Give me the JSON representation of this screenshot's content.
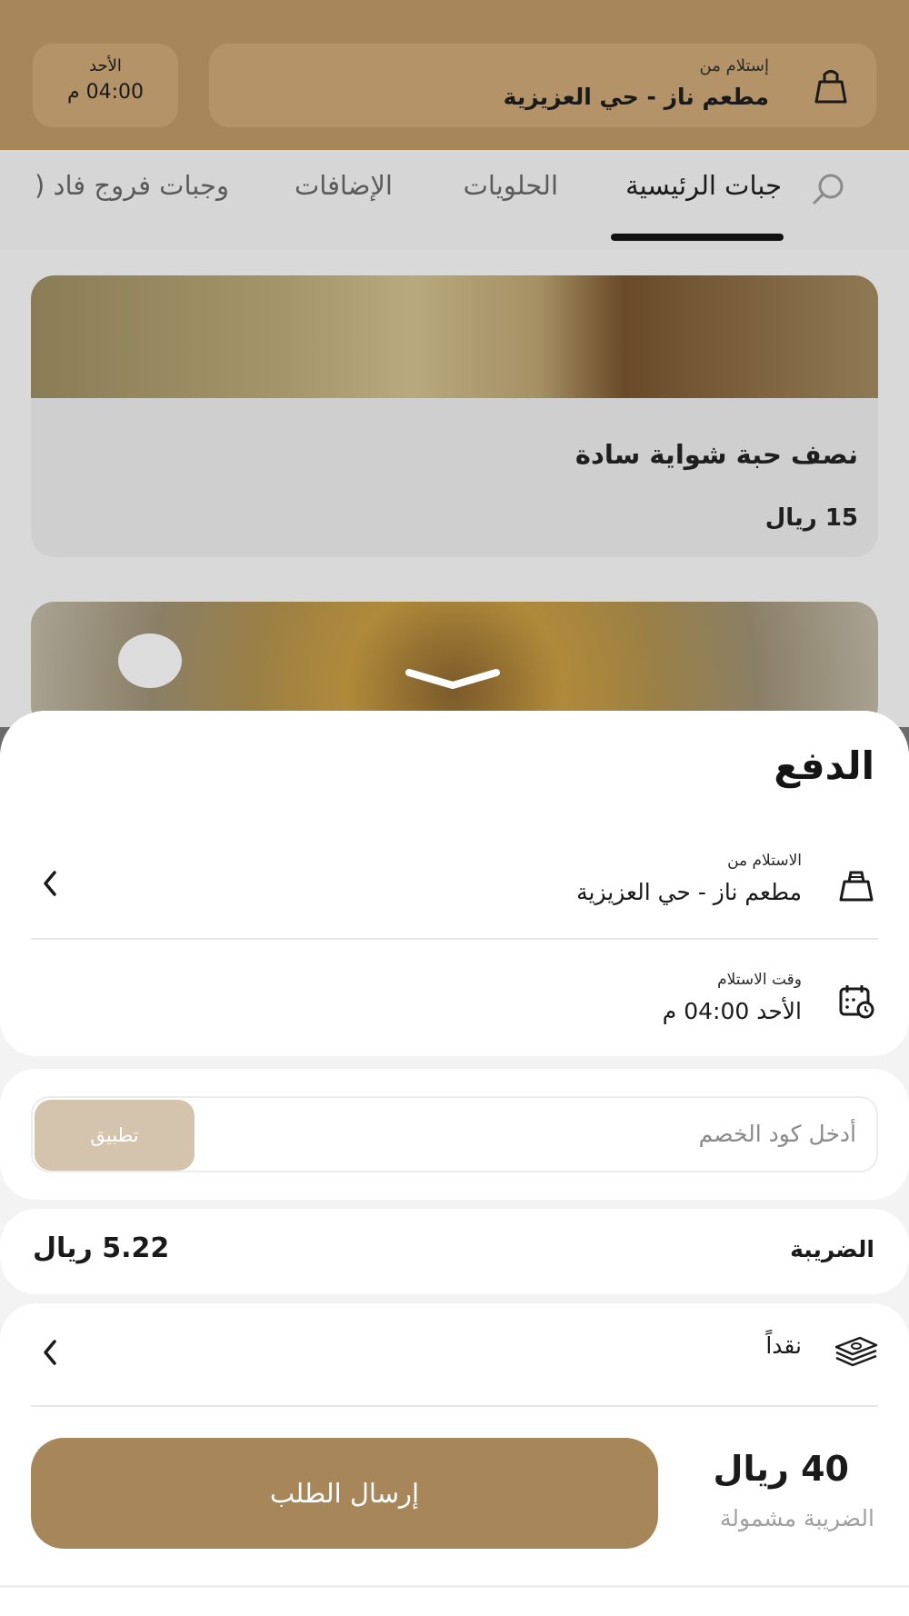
{
  "header": {
    "pickup_label": "إستلام من",
    "pickup_value": "مطعم ناز - حي العزيزية",
    "day": "الأحد",
    "time": "04:00 م"
  },
  "tabs": [
    {
      "label": "جبات الرئيسية",
      "active": true
    },
    {
      "label": "الحلويات",
      "active": false
    },
    {
      "label": "الإضافات",
      "active": false
    },
    {
      "label": "وجبات فروج فاد (",
      "active": false
    }
  ],
  "products": [
    {
      "name": "نصف حبة شواية سادة",
      "price": "15 ريال"
    }
  ],
  "sheet": {
    "title": "الدفع",
    "pickup_from_label": "الاستلام من",
    "pickup_from_value": "مطعم ناز - حي العزيزية",
    "pickup_time_label": "وقت الاستلام",
    "pickup_time_value": "الأحد 04:00 م",
    "coupon_placeholder": "أدخل كود الخصم",
    "apply_label": "تطبيق",
    "tax_label": "الضريبة",
    "tax_value": "5.22 ريال",
    "payment_method": "نقداً",
    "total": "40 ريال",
    "total_note": "الضريبة مشمولة",
    "submit_label": "إرسال الطلب"
  },
  "colors": {
    "brand": "#a7865a",
    "apply_button": "#d4c4ad"
  },
  "icons": [
    "bag-icon",
    "search-icon",
    "calendar-clock-icon",
    "cash-icon",
    "chevron-left-icon",
    "sheet-handle-icon"
  ]
}
